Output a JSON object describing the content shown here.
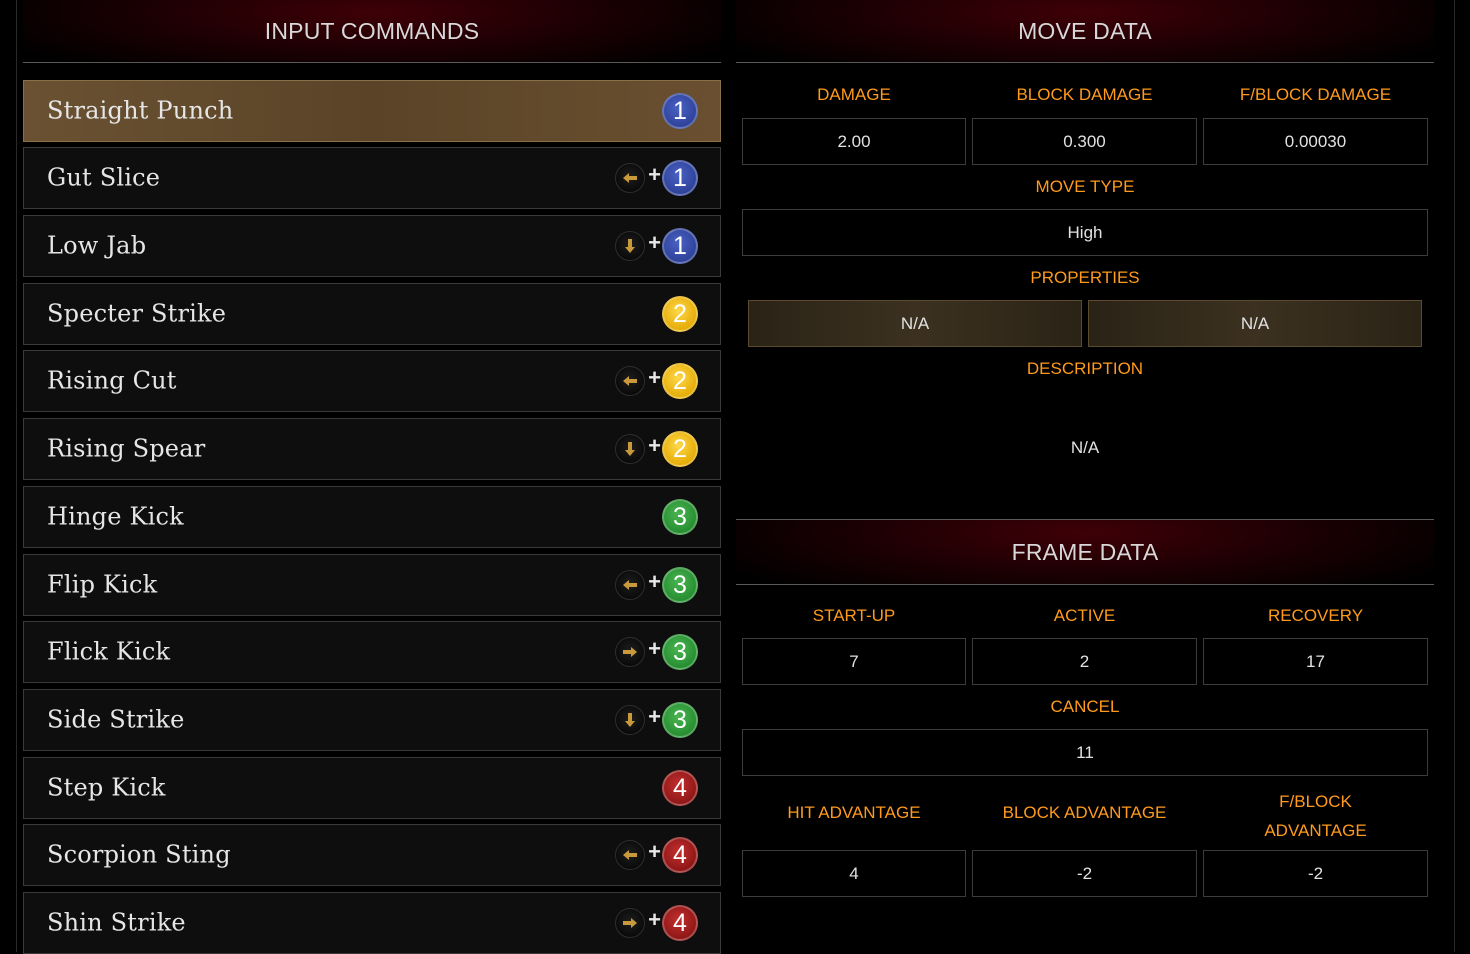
{
  "headers": {
    "input_commands": "INPUT COMMANDS",
    "move_data": "MOVE DATA",
    "frame_data": "FRAME DATA"
  },
  "moves": [
    {
      "name": "Straight Punch",
      "direction": null,
      "button": "1",
      "selected": true
    },
    {
      "name": "Gut Slice",
      "direction": "back",
      "button": "1"
    },
    {
      "name": "Low Jab",
      "direction": "down",
      "button": "1"
    },
    {
      "name": "Specter Strike",
      "direction": null,
      "button": "2"
    },
    {
      "name": "Rising Cut",
      "direction": "back",
      "button": "2"
    },
    {
      "name": "Rising Spear",
      "direction": "down",
      "button": "2"
    },
    {
      "name": "Hinge Kick",
      "direction": null,
      "button": "3"
    },
    {
      "name": "Flip Kick",
      "direction": "back",
      "button": "3"
    },
    {
      "name": "Flick Kick",
      "direction": "forward",
      "button": "3"
    },
    {
      "name": "Side Strike",
      "direction": "down",
      "button": "3"
    },
    {
      "name": "Step Kick",
      "direction": null,
      "button": "4"
    },
    {
      "name": "Scorpion Sting",
      "direction": "back",
      "button": "4"
    },
    {
      "name": "Shin Strike",
      "direction": "forward",
      "button": "4"
    }
  ],
  "plus_sign": "+",
  "move_data": {
    "damage_label": "DAMAGE",
    "damage": "2.00",
    "block_damage_label": "BLOCK DAMAGE",
    "block_damage": "0.300",
    "fblock_damage_label": "F/BLOCK DAMAGE",
    "fblock_damage": "0.00030",
    "move_type_label": "MOVE TYPE",
    "move_type": "High",
    "properties_label": "PROPERTIES",
    "properties": [
      "N/A",
      "N/A"
    ],
    "description_label": "DESCRIPTION",
    "description": "N/A"
  },
  "frame_data": {
    "startup_label": "START-UP",
    "startup": "7",
    "active_label": "ACTIVE",
    "active": "2",
    "recovery_label": "RECOVERY",
    "recovery": "17",
    "cancel_label": "CANCEL",
    "cancel": "11",
    "hit_adv_label": "HIT ADVANTAGE",
    "hit_adv": "4",
    "block_adv_label": "BLOCK ADVANTAGE",
    "block_adv": "-2",
    "fblock_adv_label_1": "F/BLOCK",
    "fblock_adv_label_2": "ADVANTAGE",
    "fblock_adv": "-2"
  },
  "colors": {
    "accent_label": "#ff9a1c",
    "button_1": "#2c3f95",
    "button_2": "#e2a800",
    "button_3": "#238a2d",
    "button_4": "#8a1414",
    "direction_arrow": "#c99a3c"
  },
  "icons": {
    "back": "arrow-left-icon",
    "forward": "arrow-right-icon",
    "down": "arrow-down-icon"
  }
}
